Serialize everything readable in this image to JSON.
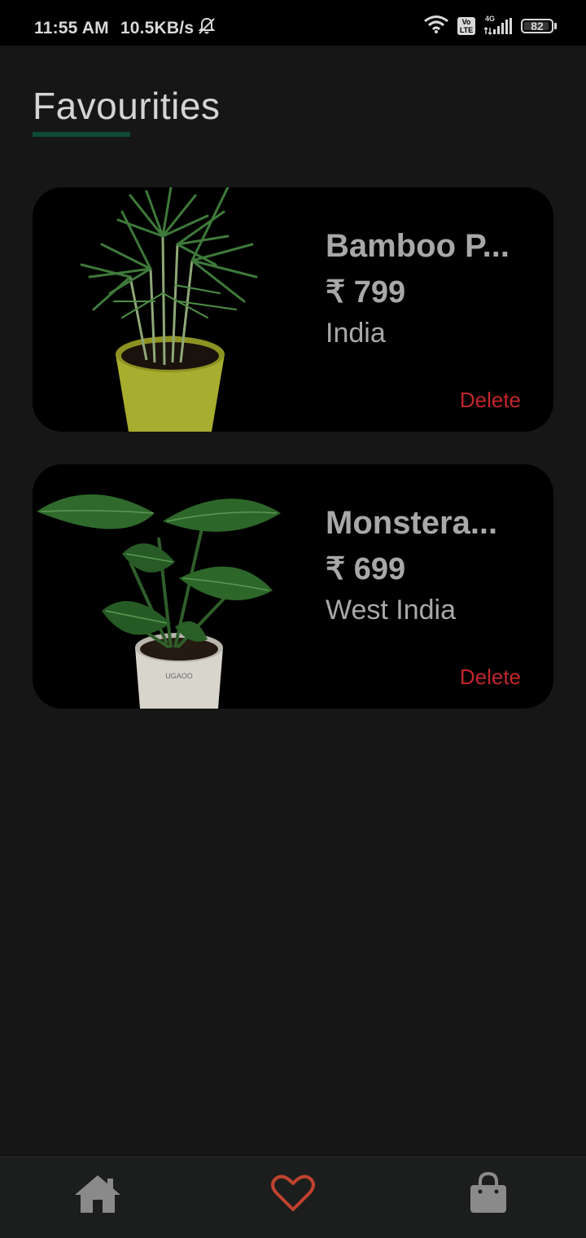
{
  "status_bar": {
    "time": "11:55 AM",
    "speed": "10.5KB/s",
    "battery": "82",
    "network": "4G",
    "volte_top": "Vo",
    "volte_bottom": "LTE"
  },
  "page": {
    "title": "Favourities"
  },
  "favourites": [
    {
      "name": "Bamboo P...",
      "price": "₹ 799",
      "region": "India",
      "delete_label": "Delete"
    },
    {
      "name": "Monstera...",
      "price": "₹ 699",
      "region": "West India",
      "delete_label": "Delete",
      "pot_label": "UGAOO"
    }
  ],
  "bottom_nav": {
    "items": [
      {
        "icon": "home-icon",
        "active": false
      },
      {
        "icon": "heart-icon",
        "active": true
      },
      {
        "icon": "shopping-bag-icon",
        "active": false
      }
    ]
  },
  "colors": {
    "background": "#161616",
    "card": "#000000",
    "accent_underline": "#0f4a37",
    "delete": "#c0262b",
    "active_nav": "#c0422f",
    "inactive_nav": "#8a8a8a"
  }
}
